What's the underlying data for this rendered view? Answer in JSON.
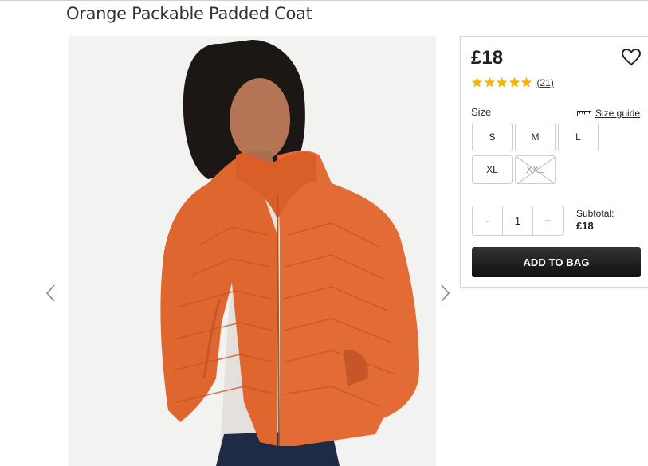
{
  "product": {
    "title": "Orange Packable Padded Coat",
    "image_alt": "Model wearing orange packable padded coat"
  },
  "gallery": {
    "prev_icon": "chevron-left-icon",
    "next_icon": "chevron-right-icon"
  },
  "purchase": {
    "price": "£18",
    "wishlist_icon": "heart-icon",
    "rating": 5,
    "review_count": "(21)",
    "size_label": "Size",
    "size_guide_label": "Size guide",
    "size_guide_icon": "ruler-icon",
    "sizes": [
      {
        "label": "S",
        "available": true
      },
      {
        "label": "M",
        "available": true
      },
      {
        "label": "L",
        "available": true
      },
      {
        "label": "XL",
        "available": true
      },
      {
        "label": "XXL",
        "available": false
      }
    ],
    "quantity": "1",
    "minus_label": "-",
    "plus_label": "+",
    "subtotal_label": "Subtotal:",
    "subtotal_value": "£18",
    "add_to_bag_label": "ADD TO BAG"
  },
  "colors": {
    "star": "#f5b400",
    "button": "#1a1a1a",
    "coat": "#e06a35"
  }
}
